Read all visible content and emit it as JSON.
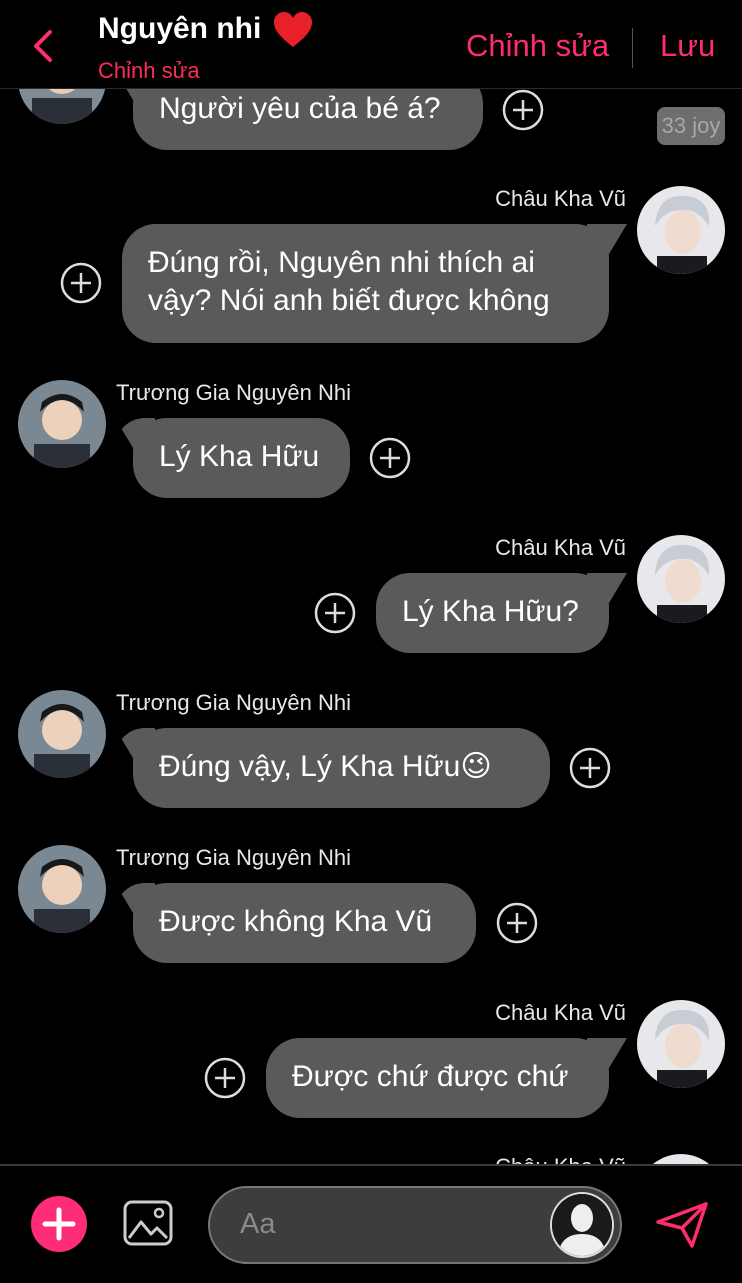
{
  "header": {
    "title": "Nguyên nhi",
    "subtitle": "Chỉnh sửa",
    "edit_label": "Chỉnh sửa",
    "save_label": "Lưu"
  },
  "chat": {
    "badge": "33 joy",
    "messages": [
      {
        "side": "left",
        "sender": "",
        "text": "Người yêu của bé á?"
      },
      {
        "side": "right",
        "sender": "Châu Kha Vũ",
        "text": [
          "Đúng rồi, Nguyên nhi thích ai",
          "vậy? Nói anh biết được không"
        ]
      },
      {
        "side": "left",
        "sender": "Trương Gia Nguyên Nhi",
        "text": "Lý Kha Hữu"
      },
      {
        "side": "right",
        "sender": "Châu Kha Vũ",
        "text": "Lý Kha Hữu?"
      },
      {
        "side": "left",
        "sender": "Trương Gia Nguyên Nhi",
        "text": "Đúng vậy, Lý Kha Hữu",
        "emoji": "😉"
      },
      {
        "side": "left",
        "sender": "Trương Gia Nguyên Nhi",
        "text": "Được không Kha Vũ"
      },
      {
        "side": "right",
        "sender": "Châu Kha Vũ",
        "text": "Được chứ được chứ"
      },
      {
        "side": "right",
        "sender": "Châu Kha Vũ",
        "text": ""
      }
    ]
  },
  "composer": {
    "placeholder": "Aa"
  },
  "colors": {
    "accent": "#ff2d6b",
    "bubble": "#5a5a5a",
    "background": "#000000"
  },
  "icons": {
    "back": "chevron-left-icon",
    "heart": "heart-icon",
    "plus": "plus-circle-icon",
    "image": "image-icon",
    "send": "send-icon"
  }
}
